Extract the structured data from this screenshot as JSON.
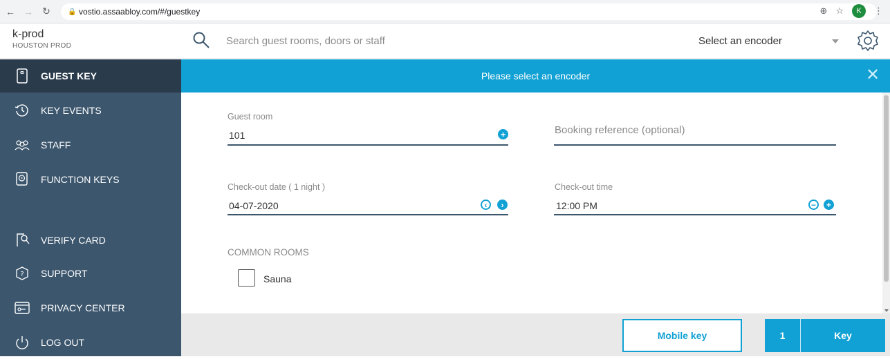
{
  "browser": {
    "url": "vostio.assaabloy.com/#/guestkey",
    "profile_initial": "K"
  },
  "header": {
    "org_name": "k-prod",
    "site_name": "HOUSTON PROD",
    "search_placeholder": "Search guest rooms, doors or staff",
    "encoder_placeholder": "Select an encoder"
  },
  "sidebar": {
    "items": [
      {
        "label": "GUEST KEY",
        "icon": "guest-key-icon",
        "active": true
      },
      {
        "label": "KEY EVENTS",
        "icon": "history-icon"
      },
      {
        "label": "STAFF",
        "icon": "staff-icon"
      },
      {
        "label": "FUNCTION KEYS",
        "icon": "function-keys-icon"
      },
      {
        "label": "VERIFY CARD",
        "icon": "verify-card-icon"
      },
      {
        "label": "SUPPORT",
        "icon": "support-icon"
      },
      {
        "label": "PRIVACY CENTER",
        "icon": "privacy-center-icon"
      },
      {
        "label": "LOG OUT",
        "icon": "power-icon"
      }
    ]
  },
  "banner": {
    "message": "Please select an encoder"
  },
  "form": {
    "guest_room": {
      "label": "Guest room",
      "value": "101"
    },
    "booking_reference": {
      "placeholder": "Booking reference (optional)"
    },
    "checkout_date": {
      "label": "Check-out date ( 1 night )",
      "value": "04-07-2020"
    },
    "checkout_time": {
      "label": "Check-out time",
      "value": "12:00 PM"
    },
    "common_rooms": {
      "title": "COMMON ROOMS",
      "rooms": [
        {
          "label": "Sauna",
          "checked": false
        }
      ]
    }
  },
  "footer": {
    "mobile_key_label": "Mobile key",
    "key_count": "1",
    "key_label": "Key"
  },
  "colors": {
    "accent": "#12a1d4",
    "sidebar": "#3c566d",
    "sidebar_active": "#2a3b4c"
  }
}
